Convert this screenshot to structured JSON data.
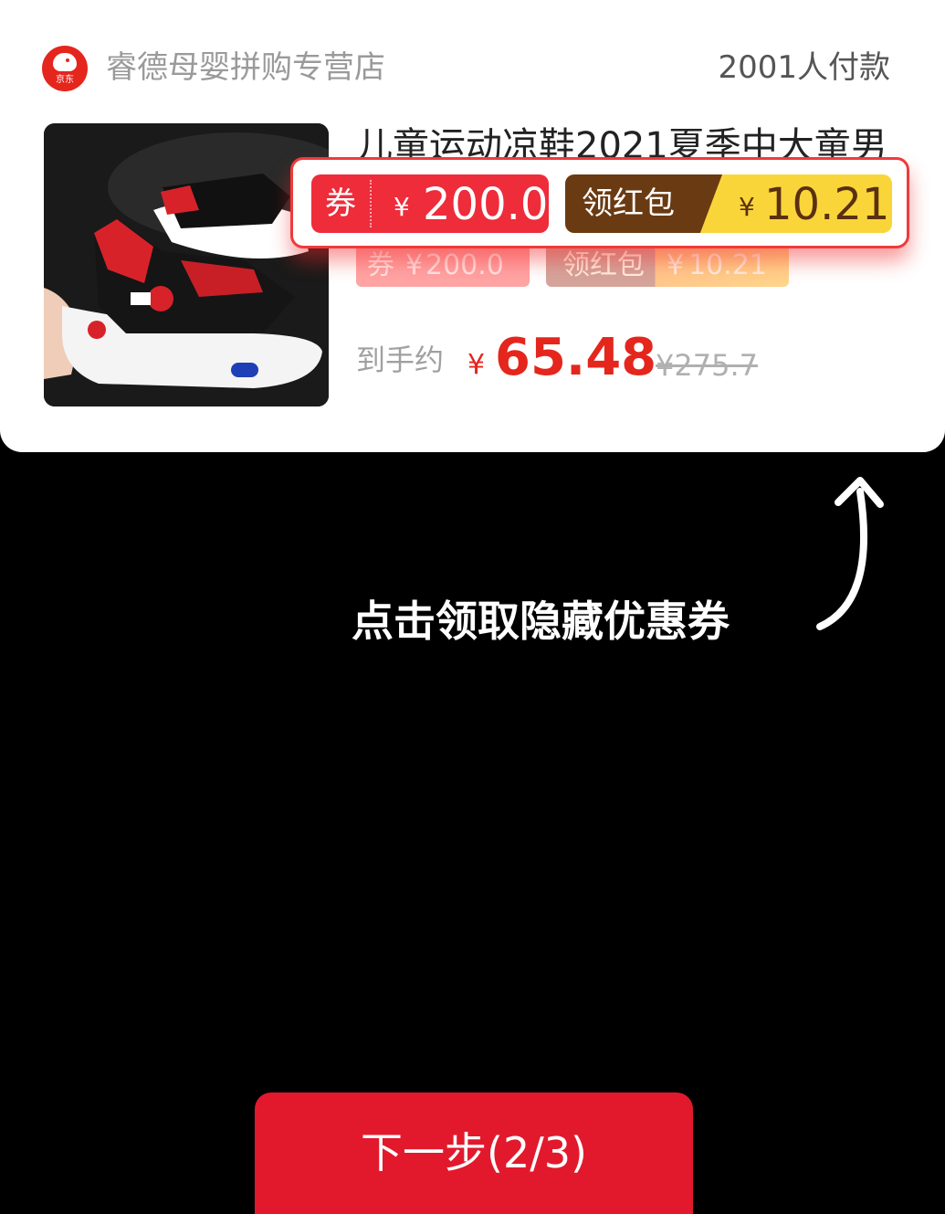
{
  "shop": {
    "logo_text": "京东",
    "name": "睿德母婴拼购专营店",
    "sold_count": "2001人付款"
  },
  "product": {
    "title": "儿童运动凉鞋2021夏季中大童男",
    "image": "product-photo",
    "coupon": {
      "label": "券",
      "currency": "¥",
      "amount": "200.0"
    },
    "red_packet": {
      "label": "领红包",
      "currency": "¥",
      "amount": "10.21"
    },
    "price": {
      "label": "到手约",
      "currency": "¥",
      "value": "65.48",
      "original": "¥275.7"
    }
  },
  "guide": {
    "hint": "点击领取隐藏优惠券"
  },
  "footer": {
    "next_label": "下一步(2/3)"
  },
  "colors": {
    "accent": "#e4261d",
    "coupon_bg": "#ee2c3a",
    "redpack_left": "#6a3a12",
    "redpack_right": "#f9d53a",
    "button": "#e2192c"
  }
}
